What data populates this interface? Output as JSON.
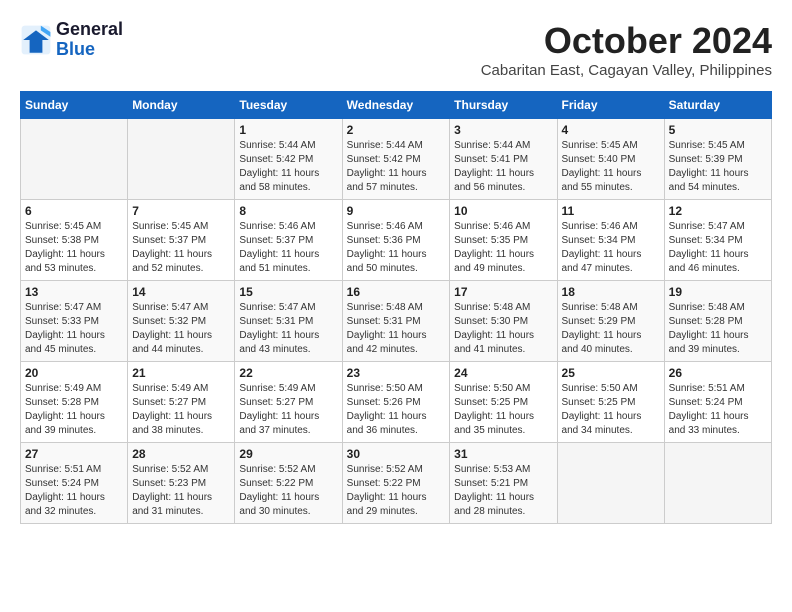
{
  "logo": {
    "line1": "General",
    "line2": "Blue"
  },
  "title": "October 2024",
  "location": "Cabaritan East, Cagayan Valley, Philippines",
  "days_of_week": [
    "Sunday",
    "Monday",
    "Tuesday",
    "Wednesday",
    "Thursday",
    "Friday",
    "Saturday"
  ],
  "weeks": [
    [
      {
        "day": "",
        "info": ""
      },
      {
        "day": "",
        "info": ""
      },
      {
        "day": "1",
        "info": "Sunrise: 5:44 AM\nSunset: 5:42 PM\nDaylight: 11 hours and 58 minutes."
      },
      {
        "day": "2",
        "info": "Sunrise: 5:44 AM\nSunset: 5:42 PM\nDaylight: 11 hours and 57 minutes."
      },
      {
        "day": "3",
        "info": "Sunrise: 5:44 AM\nSunset: 5:41 PM\nDaylight: 11 hours and 56 minutes."
      },
      {
        "day": "4",
        "info": "Sunrise: 5:45 AM\nSunset: 5:40 PM\nDaylight: 11 hours and 55 minutes."
      },
      {
        "day": "5",
        "info": "Sunrise: 5:45 AM\nSunset: 5:39 PM\nDaylight: 11 hours and 54 minutes."
      }
    ],
    [
      {
        "day": "6",
        "info": "Sunrise: 5:45 AM\nSunset: 5:38 PM\nDaylight: 11 hours and 53 minutes."
      },
      {
        "day": "7",
        "info": "Sunrise: 5:45 AM\nSunset: 5:37 PM\nDaylight: 11 hours and 52 minutes."
      },
      {
        "day": "8",
        "info": "Sunrise: 5:46 AM\nSunset: 5:37 PM\nDaylight: 11 hours and 51 minutes."
      },
      {
        "day": "9",
        "info": "Sunrise: 5:46 AM\nSunset: 5:36 PM\nDaylight: 11 hours and 50 minutes."
      },
      {
        "day": "10",
        "info": "Sunrise: 5:46 AM\nSunset: 5:35 PM\nDaylight: 11 hours and 49 minutes."
      },
      {
        "day": "11",
        "info": "Sunrise: 5:46 AM\nSunset: 5:34 PM\nDaylight: 11 hours and 47 minutes."
      },
      {
        "day": "12",
        "info": "Sunrise: 5:47 AM\nSunset: 5:34 PM\nDaylight: 11 hours and 46 minutes."
      }
    ],
    [
      {
        "day": "13",
        "info": "Sunrise: 5:47 AM\nSunset: 5:33 PM\nDaylight: 11 hours and 45 minutes."
      },
      {
        "day": "14",
        "info": "Sunrise: 5:47 AM\nSunset: 5:32 PM\nDaylight: 11 hours and 44 minutes."
      },
      {
        "day": "15",
        "info": "Sunrise: 5:47 AM\nSunset: 5:31 PM\nDaylight: 11 hours and 43 minutes."
      },
      {
        "day": "16",
        "info": "Sunrise: 5:48 AM\nSunset: 5:31 PM\nDaylight: 11 hours and 42 minutes."
      },
      {
        "day": "17",
        "info": "Sunrise: 5:48 AM\nSunset: 5:30 PM\nDaylight: 11 hours and 41 minutes."
      },
      {
        "day": "18",
        "info": "Sunrise: 5:48 AM\nSunset: 5:29 PM\nDaylight: 11 hours and 40 minutes."
      },
      {
        "day": "19",
        "info": "Sunrise: 5:48 AM\nSunset: 5:28 PM\nDaylight: 11 hours and 39 minutes."
      }
    ],
    [
      {
        "day": "20",
        "info": "Sunrise: 5:49 AM\nSunset: 5:28 PM\nDaylight: 11 hours and 39 minutes."
      },
      {
        "day": "21",
        "info": "Sunrise: 5:49 AM\nSunset: 5:27 PM\nDaylight: 11 hours and 38 minutes."
      },
      {
        "day": "22",
        "info": "Sunrise: 5:49 AM\nSunset: 5:27 PM\nDaylight: 11 hours and 37 minutes."
      },
      {
        "day": "23",
        "info": "Sunrise: 5:50 AM\nSunset: 5:26 PM\nDaylight: 11 hours and 36 minutes."
      },
      {
        "day": "24",
        "info": "Sunrise: 5:50 AM\nSunset: 5:25 PM\nDaylight: 11 hours and 35 minutes."
      },
      {
        "day": "25",
        "info": "Sunrise: 5:50 AM\nSunset: 5:25 PM\nDaylight: 11 hours and 34 minutes."
      },
      {
        "day": "26",
        "info": "Sunrise: 5:51 AM\nSunset: 5:24 PM\nDaylight: 11 hours and 33 minutes."
      }
    ],
    [
      {
        "day": "27",
        "info": "Sunrise: 5:51 AM\nSunset: 5:24 PM\nDaylight: 11 hours and 32 minutes."
      },
      {
        "day": "28",
        "info": "Sunrise: 5:52 AM\nSunset: 5:23 PM\nDaylight: 11 hours and 31 minutes."
      },
      {
        "day": "29",
        "info": "Sunrise: 5:52 AM\nSunset: 5:22 PM\nDaylight: 11 hours and 30 minutes."
      },
      {
        "day": "30",
        "info": "Sunrise: 5:52 AM\nSunset: 5:22 PM\nDaylight: 11 hours and 29 minutes."
      },
      {
        "day": "31",
        "info": "Sunrise: 5:53 AM\nSunset: 5:21 PM\nDaylight: 11 hours and 28 minutes."
      },
      {
        "day": "",
        "info": ""
      },
      {
        "day": "",
        "info": ""
      }
    ]
  ]
}
